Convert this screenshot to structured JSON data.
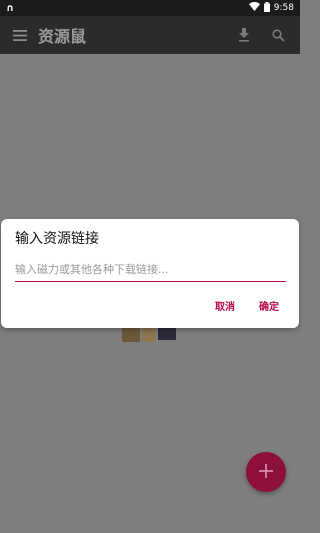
{
  "status_bar": {
    "left_indicator": "∩",
    "time": "9:58",
    "icons": [
      "wifi-icon",
      "battery-icon"
    ]
  },
  "app_bar": {
    "title": "资源鼠",
    "icons": [
      "menu-icon",
      "download-icon",
      "search-icon"
    ]
  },
  "dialog": {
    "title": "输入资源链接",
    "input_value": "",
    "input_placeholder": "输入磁力或其他各种下载链接...",
    "cancel_label": "取消",
    "confirm_label": "确定"
  },
  "fab": {
    "icon": "plus-icon"
  },
  "colors": {
    "accent": "#b8094d",
    "fab": "#8c0f3c",
    "app_bar": "#2b2b2b",
    "status_bar": "#1b1b1b",
    "scrim": "#7e7e7e"
  }
}
